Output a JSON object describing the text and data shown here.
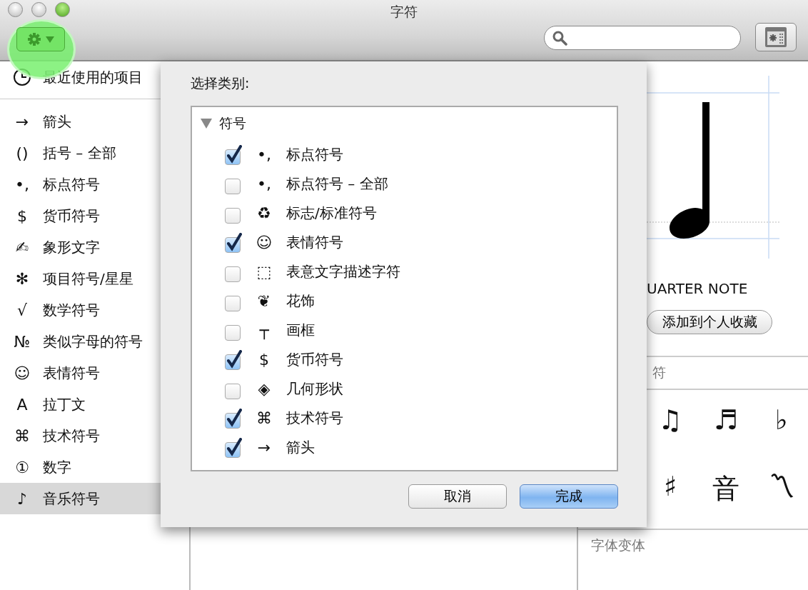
{
  "window": {
    "title": "字符"
  },
  "sidebar": {
    "recent": {
      "label": "最近使用的项目",
      "selected": false
    },
    "items": [
      {
        "glyph": "→",
        "label": "箭头",
        "selected": false
      },
      {
        "glyph": "()",
        "label": "括号 – 全部",
        "selected": false
      },
      {
        "glyph": "•,",
        "label": "标点符号",
        "selected": false
      },
      {
        "glyph": "$",
        "label": "货币符号",
        "selected": false
      },
      {
        "glyph": "✍",
        "label": "象形文字",
        "selected": false
      },
      {
        "glyph": "✻",
        "label": "项目符号/星星",
        "selected": false
      },
      {
        "glyph": "√",
        "label": "数学符号",
        "selected": false
      },
      {
        "glyph": "№",
        "label": "类似字母的符号",
        "selected": false
      },
      {
        "glyph": "☺",
        "label": "表情符号",
        "selected": false
      },
      {
        "glyph": "A",
        "label": "拉丁文",
        "selected": false
      },
      {
        "glyph": "⌘",
        "label": "技术符号",
        "selected": false
      },
      {
        "glyph": "①",
        "label": "数字",
        "selected": false
      },
      {
        "glyph": "♪",
        "label": "音乐符号",
        "selected": true
      }
    ]
  },
  "detail": {
    "name": "UARTER NOTE",
    "favorite_button": "添加到个人收藏",
    "related_title": "符",
    "related": [
      "♫",
      "♬",
      "♭",
      "♯",
      "音",
      "〽"
    ],
    "variants_title": "字体变体"
  },
  "sheet": {
    "prompt": "选择类别:",
    "group": {
      "label": "符号",
      "expanded": true,
      "children": [
        {
          "glyph": "•,",
          "label": "标点符号",
          "checked": true
        },
        {
          "glyph": "•,",
          "label": "标点符号 – 全部",
          "checked": false
        },
        {
          "glyph": "♻",
          "label": "标志/标准符号",
          "checked": false
        },
        {
          "glyph": "☺",
          "label": "表情符号",
          "checked": true
        },
        {
          "glyph": "⬚",
          "label": "表意文字描述字符",
          "checked": false
        },
        {
          "glyph": "❦",
          "label": "花饰",
          "checked": false
        },
        {
          "glyph": "┬",
          "label": "画框",
          "checked": false
        },
        {
          "glyph": "$",
          "label": "货币符号",
          "checked": true
        },
        {
          "glyph": "◈",
          "label": "几何形状",
          "checked": false
        },
        {
          "glyph": "⌘",
          "label": "技术符号",
          "checked": true
        },
        {
          "glyph": "→",
          "label": "箭头",
          "checked": true
        }
      ]
    },
    "buttons": [
      {
        "label": "取消",
        "kind": "cancel"
      },
      {
        "label": "完成",
        "kind": "default"
      }
    ]
  }
}
